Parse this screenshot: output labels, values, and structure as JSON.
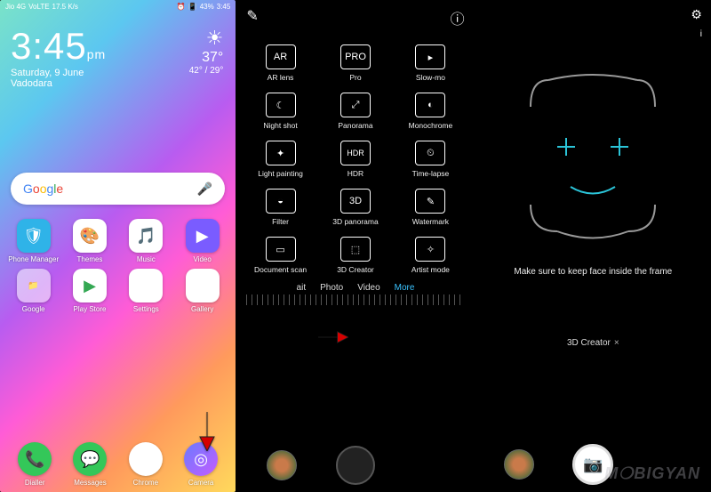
{
  "status_bar": {
    "network": "Jio 4G",
    "volte": "VoLTE",
    "speed": "17.5 K/s",
    "alarm": "⏰",
    "vibrate": "📳",
    "battery_pct": "43%",
    "time": "3:45"
  },
  "clock": {
    "time": "3:45",
    "ampm": "pm",
    "date": "Saturday, 9 June",
    "city": "Vadodara"
  },
  "weather": {
    "icon": "☀",
    "temp": "37°",
    "range": "42° / 29°"
  },
  "search": {
    "logo_parts": [
      "G",
      "o",
      "o",
      "g",
      "l",
      "e"
    ]
  },
  "home_apps": [
    {
      "label": "Phone Manager",
      "glyph": "🛡",
      "bg": "#2fb3e8"
    },
    {
      "label": "Themes",
      "glyph": "🎨",
      "bg": "#fff"
    },
    {
      "label": "Music",
      "glyph": "🎵",
      "bg": "#fff"
    },
    {
      "label": "Video",
      "glyph": "▶",
      "bg": "#fff"
    },
    {
      "label": "Google",
      "glyph": "📁",
      "bg": "rgba(255,255,255,.6)"
    },
    {
      "label": "Play Store",
      "glyph": "▶",
      "bg": "#fff"
    },
    {
      "label": "Settings",
      "glyph": "⚙",
      "bg": "#fff"
    },
    {
      "label": "Gallery",
      "glyph": "🖼",
      "bg": "#fff"
    }
  ],
  "dock_apps": [
    {
      "label": "Dialler",
      "glyph": "📞",
      "bg": "#34c759"
    },
    {
      "label": "Messages",
      "glyph": "💬",
      "bg": "#34c759"
    },
    {
      "label": "Chrome",
      "glyph": "◉",
      "bg": "#fff"
    },
    {
      "label": "Camera",
      "glyph": "◎",
      "bg": "#5a68ff"
    }
  ],
  "modes_panel": {
    "edit_icon": "✎",
    "info_icon": "ⓘ",
    "modes": [
      {
        "label": "AR lens",
        "glyph": "AR"
      },
      {
        "label": "Pro",
        "glyph": "PRO"
      },
      {
        "label": "Slow-mo",
        "glyph": "▸"
      },
      {
        "label": "Night shot",
        "glyph": "☾"
      },
      {
        "label": "Panorama",
        "glyph": "⤢"
      },
      {
        "label": "Monochrome",
        "glyph": "◐"
      },
      {
        "label": "Light painting",
        "glyph": "✦"
      },
      {
        "label": "HDR",
        "glyph": "HDR"
      },
      {
        "label": "Time-lapse",
        "glyph": "⏲"
      },
      {
        "label": "Filter",
        "glyph": "◒"
      },
      {
        "label": "3D panorama",
        "glyph": "3D"
      },
      {
        "label": "Watermark",
        "glyph": "✎"
      },
      {
        "label": "Document scan",
        "glyph": "▭"
      },
      {
        "label": "3D Creator",
        "glyph": "⬚"
      },
      {
        "label": "Artist mode",
        "glyph": "✧"
      }
    ],
    "tabs": {
      "t0": "ait",
      "t1": "Photo",
      "t2": "Video",
      "t3": "More"
    }
  },
  "creator_panel": {
    "settings_icon": "⚙",
    "info_icon": "i",
    "hint": "Make sure to keep face inside the frame",
    "mode_label": "3D Creator",
    "close": "×",
    "shutter_icon": "📷"
  },
  "watermark": "M❍BIGYAN"
}
